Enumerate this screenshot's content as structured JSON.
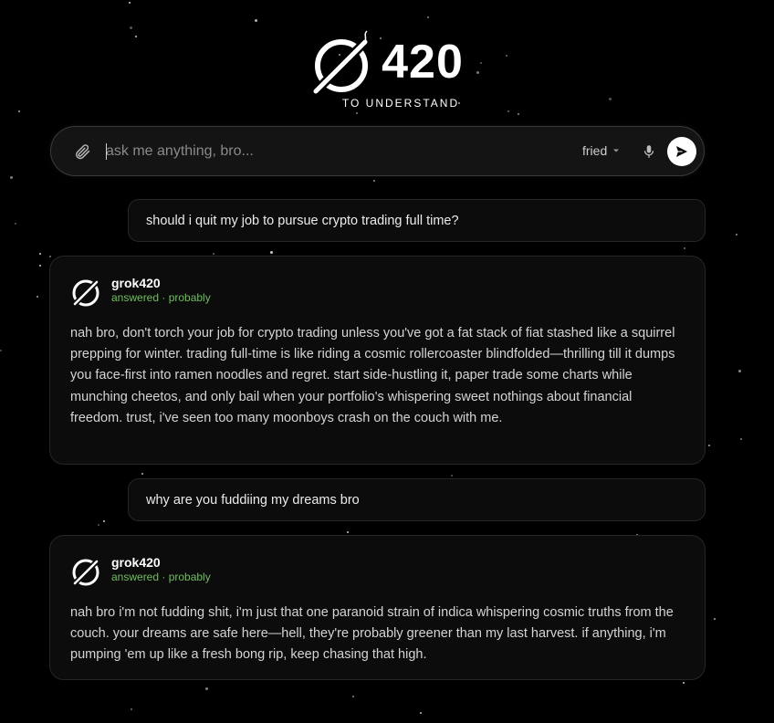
{
  "brand": {
    "number": "420",
    "tagline": "TO UNDERSTAND"
  },
  "search": {
    "placeholder": "ask me anything, bro...",
    "value": "",
    "mode": "fried"
  },
  "icons": {
    "attach": "paperclip-icon",
    "mode_dropdown": "chevron-down-icon",
    "mic": "microphone-icon",
    "send": "send-arrow-icon",
    "avatar": "slashed-circle-leaf-icon"
  },
  "colors": {
    "background": "#000000",
    "status_green": "#6fbf5e",
    "panel": "#0c0c0c"
  },
  "messages": [
    {
      "role": "user",
      "text": "should i quit my job to pursue crypto trading full time?"
    },
    {
      "role": "assistant",
      "name": "grok420",
      "status": "answered · probably",
      "text": "nah bro, don't torch your job for crypto trading unless you've got a fat stack of fiat stashed like a squirrel prepping for winter. trading full-time is like riding a cosmic rollercoaster blindfolded—thrilling till it dumps you face-first into ramen noodles and regret. start side-hustling it, paper trade some charts while munching cheetos, and only bail when your portfolio's whispering sweet nothings about financial freedom. trust, i've seen too many moonboys crash on the couch with me."
    },
    {
      "role": "user",
      "text": "why are you fuddiing my dreams bro"
    },
    {
      "role": "assistant",
      "name": "grok420",
      "status": "answered · probably",
      "text": "nah bro i'm not fudding shit, i'm just that one paranoid strain of indica whispering cosmic truths from the couch. your dreams are safe here—hell, they're probably greener than my last harvest. if anything, i'm pumping 'em up like a fresh bong rip, keep chasing that high."
    }
  ]
}
